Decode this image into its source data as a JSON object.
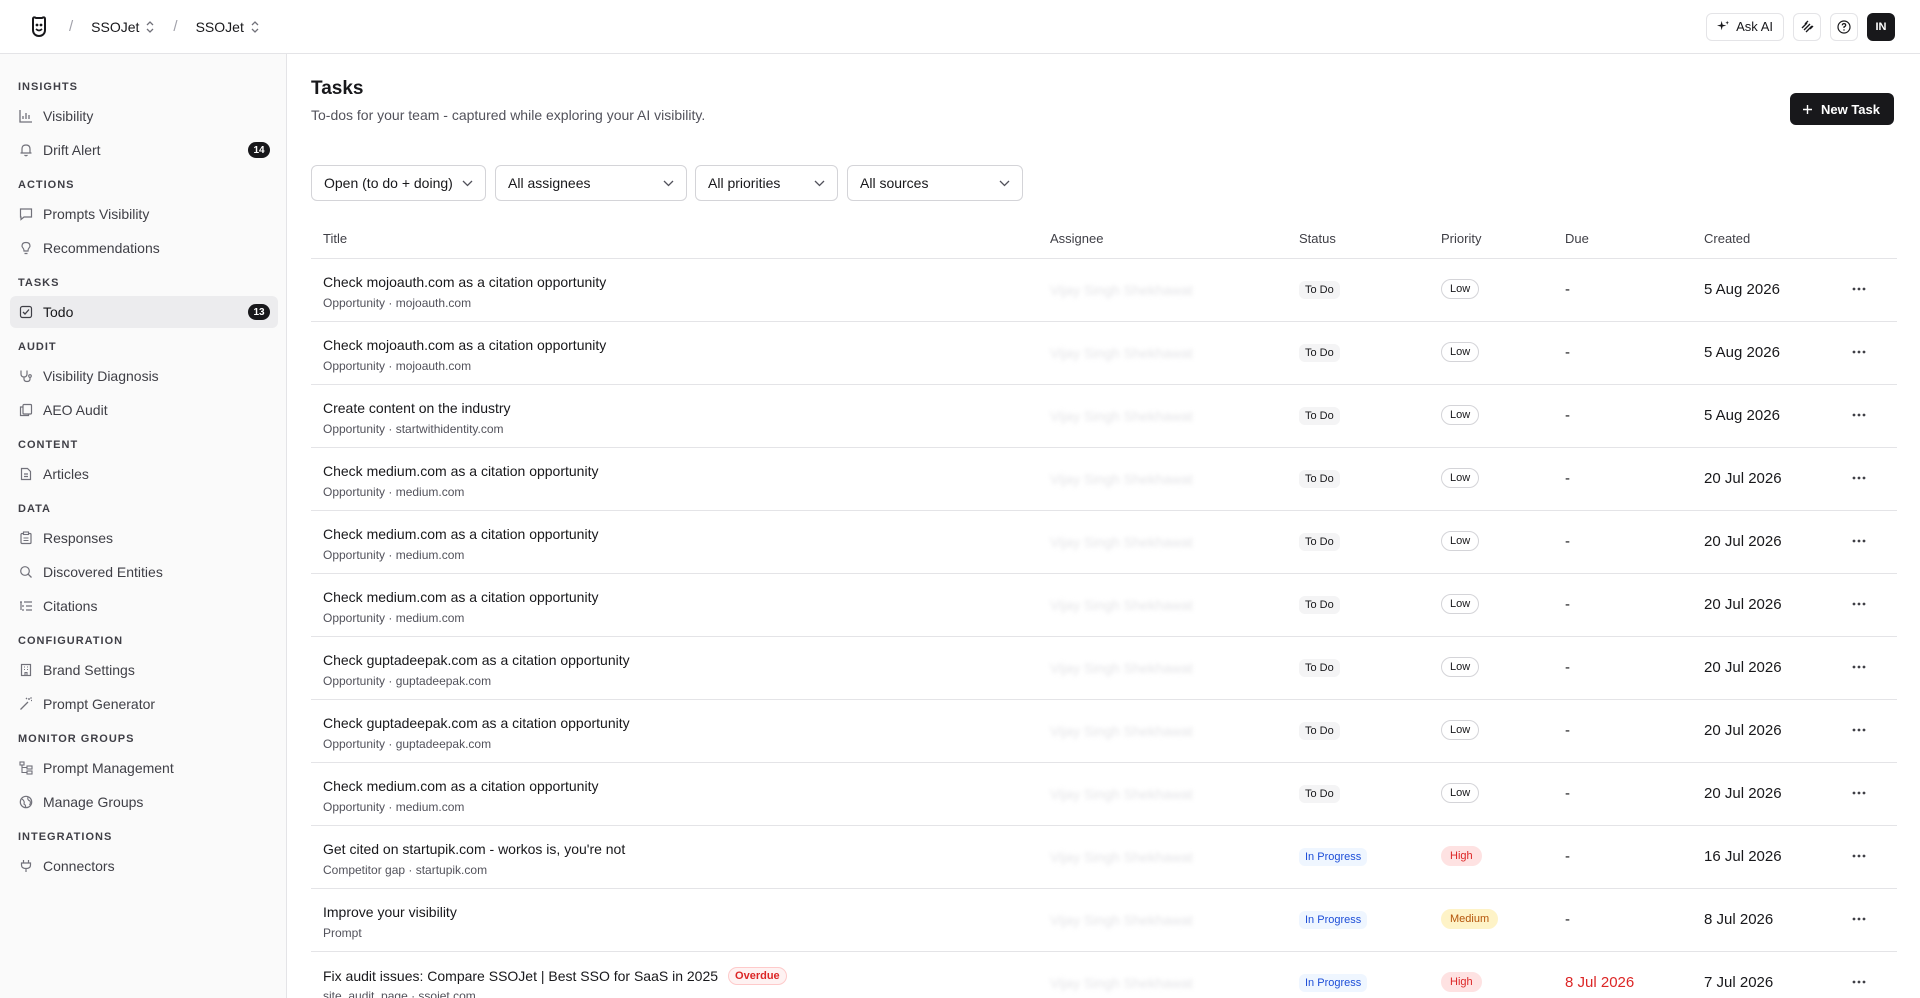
{
  "topbar": {
    "breadcrumb": [
      "SSOJet",
      "SSOJet"
    ],
    "ask_ai": "Ask AI",
    "avatar_initials": "IN"
  },
  "sidebar": {
    "sections": [
      {
        "title": "INSIGHTS",
        "items": [
          {
            "label": "Visibility",
            "icon": "bar-chart-icon"
          },
          {
            "label": "Drift Alert",
            "icon": "bell-icon",
            "badge": "14"
          }
        ]
      },
      {
        "title": "ACTIONS",
        "items": [
          {
            "label": "Prompts Visibility",
            "icon": "message-icon"
          },
          {
            "label": "Recommendations",
            "icon": "lightbulb-icon"
          }
        ]
      },
      {
        "title": "TASKS",
        "items": [
          {
            "label": "Todo",
            "icon": "checkbox-icon",
            "badge": "13",
            "active": true
          }
        ]
      },
      {
        "title": "AUDIT",
        "items": [
          {
            "label": "Visibility Diagnosis",
            "icon": "stethoscope-icon"
          },
          {
            "label": "AEO Audit",
            "icon": "copy-icon"
          }
        ]
      },
      {
        "title": "CONTENT",
        "items": [
          {
            "label": "Articles",
            "icon": "file-icon"
          }
        ]
      },
      {
        "title": "DATA",
        "items": [
          {
            "label": "Responses",
            "icon": "clipboard-icon"
          },
          {
            "label": "Discovered Entities",
            "icon": "search-icon"
          },
          {
            "label": "Citations",
            "icon": "list-icon"
          }
        ]
      },
      {
        "title": "CONFIGURATION",
        "items": [
          {
            "label": "Brand Settings",
            "icon": "building-icon"
          },
          {
            "label": "Prompt Generator",
            "icon": "wand-icon"
          }
        ]
      },
      {
        "title": "MONITOR GROUPS",
        "items": [
          {
            "label": "Prompt Management",
            "icon": "tree-icon"
          },
          {
            "label": "Manage Groups",
            "icon": "globe-icon"
          }
        ]
      },
      {
        "title": "INTEGRATIONS",
        "items": [
          {
            "label": "Connectors",
            "icon": "plug-icon"
          }
        ]
      }
    ]
  },
  "page": {
    "title": "Tasks",
    "subtitle": "To-dos for your team - captured while exploring your AI visibility.",
    "new_task": "New Task"
  },
  "filters": {
    "status": "Open (to do + doing)",
    "assignee": "All assignees",
    "priority": "All priorities",
    "source": "All sources"
  },
  "table": {
    "headers": {
      "title": "Title",
      "assignee": "Assignee",
      "status": "Status",
      "priority": "Priority",
      "due": "Due",
      "created": "Created"
    },
    "rows": [
      {
        "title": "Check mojoauth.com as a citation opportunity",
        "meta": "Opportunity · mojoauth.com",
        "assignee": "Vijay Singh Shekhawat",
        "status": "To Do",
        "priority": "Low",
        "due": "-",
        "created": "5 Aug 2026"
      },
      {
        "title": "Check mojoauth.com as a citation opportunity",
        "meta": "Opportunity · mojoauth.com",
        "assignee": "Vijay Singh Shekhawat",
        "status": "To Do",
        "priority": "Low",
        "due": "-",
        "created": "5 Aug 2026"
      },
      {
        "title": "Create content on the industry",
        "meta": "Opportunity · startwithidentity.com",
        "assignee": "Vijay Singh Shekhawat",
        "status": "To Do",
        "priority": "Low",
        "due": "-",
        "created": "5 Aug 2026"
      },
      {
        "title": "Check medium.com as a citation opportunity",
        "meta": "Opportunity · medium.com",
        "assignee": "Vijay Singh Shekhawat",
        "status": "To Do",
        "priority": "Low",
        "due": "-",
        "created": "20 Jul 2026"
      },
      {
        "title": "Check medium.com as a citation opportunity",
        "meta": "Opportunity · medium.com",
        "assignee": "Vijay Singh Shekhawat",
        "status": "To Do",
        "priority": "Low",
        "due": "-",
        "created": "20 Jul 2026"
      },
      {
        "title": "Check medium.com as a citation opportunity",
        "meta": "Opportunity · medium.com",
        "assignee": "Vijay Singh Shekhawat",
        "status": "To Do",
        "priority": "Low",
        "due": "-",
        "created": "20 Jul 2026"
      },
      {
        "title": "Check guptadeepak.com as a citation opportunity",
        "meta": "Opportunity · guptadeepak.com",
        "assignee": "Vijay Singh Shekhawat",
        "status": "To Do",
        "priority": "Low",
        "due": "-",
        "created": "20 Jul 2026"
      },
      {
        "title": "Check guptadeepak.com as a citation opportunity",
        "meta": "Opportunity · guptadeepak.com",
        "assignee": "Vijay Singh Shekhawat",
        "status": "To Do",
        "priority": "Low",
        "due": "-",
        "created": "20 Jul 2026"
      },
      {
        "title": "Check medium.com as a citation opportunity",
        "meta": "Opportunity · medium.com",
        "assignee": "Vijay Singh Shekhawat",
        "status": "To Do",
        "priority": "Low",
        "due": "-",
        "created": "20 Jul 2026"
      },
      {
        "title": "Get cited on startupik.com - workos is, you're not",
        "meta": "Competitor gap · startupik.com",
        "assignee": "Vijay Singh Shekhawat",
        "status": "In Progress",
        "priority": "High",
        "due": "-",
        "created": "16 Jul 2026"
      },
      {
        "title": "Improve your visibility",
        "meta": "Prompt",
        "assignee": "Vijay Singh Shekhawat",
        "status": "In Progress",
        "priority": "Medium",
        "due": "-",
        "created": "8 Jul 2026"
      },
      {
        "title": "Fix audit issues: Compare SSOJet | Best SSO for SaaS in 2025",
        "overdue": "Overdue",
        "meta": "site_audit_page · ssojet.com",
        "assignee": "Vijay Singh Shekhawat",
        "status": "In Progress",
        "priority": "High",
        "due": "8 Jul 2026",
        "created": "7 Jul 2026"
      }
    ]
  }
}
